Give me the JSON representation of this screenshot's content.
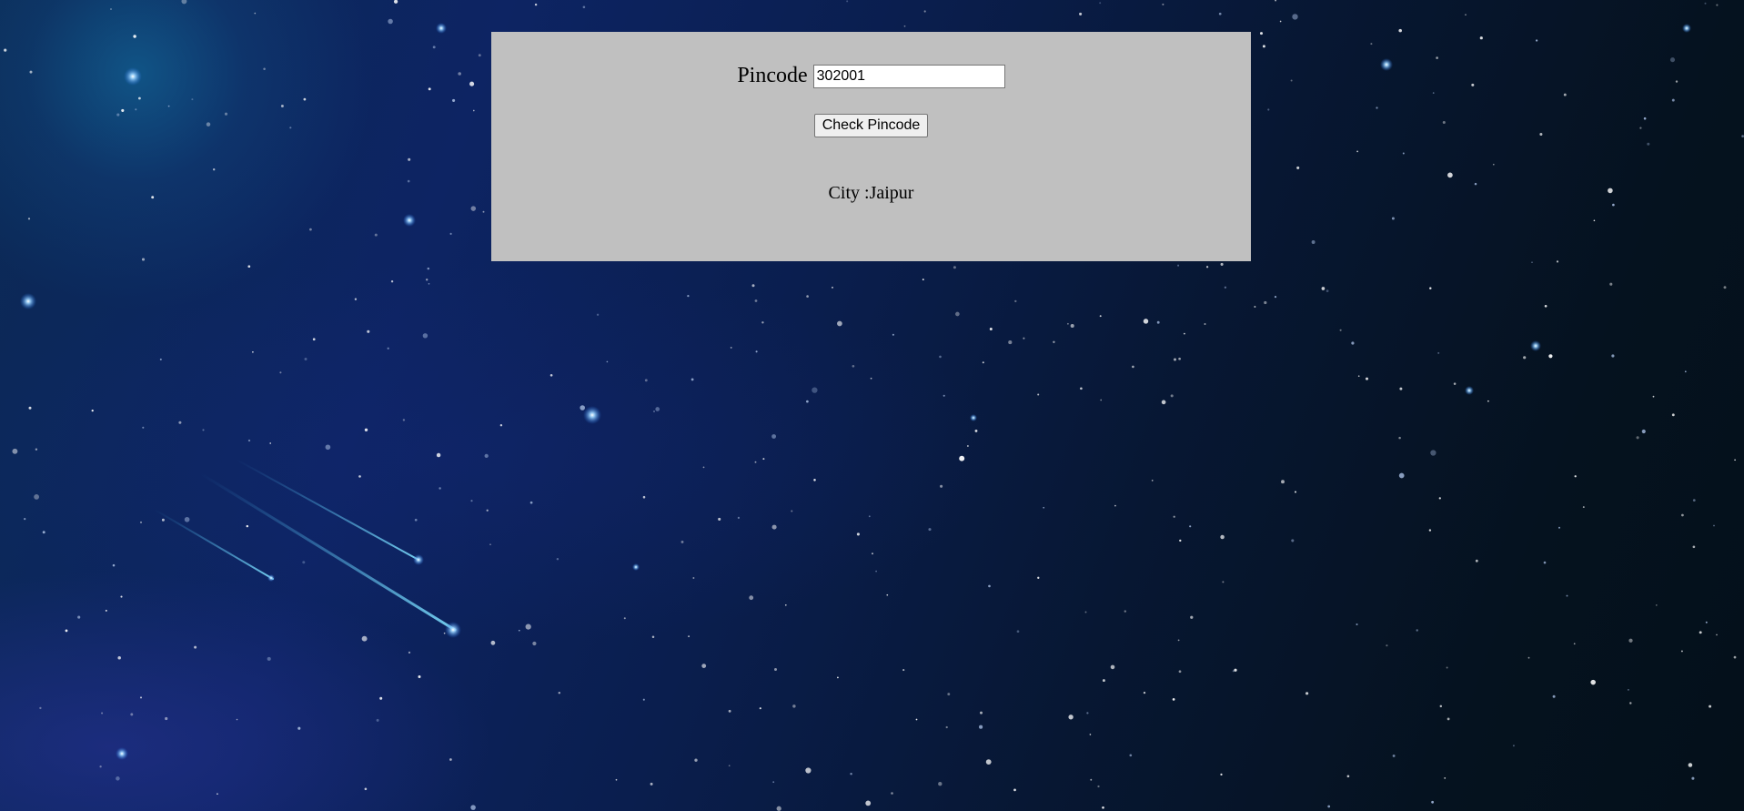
{
  "form": {
    "pincode_label": "Pincode",
    "pincode_value": "302001",
    "check_button_label": "Check Pincode",
    "result_prefix": "City :",
    "result_city": "Jaipur"
  },
  "colors": {
    "panel_background": "#c0c0c0",
    "page_background": "#0a1e4e"
  }
}
